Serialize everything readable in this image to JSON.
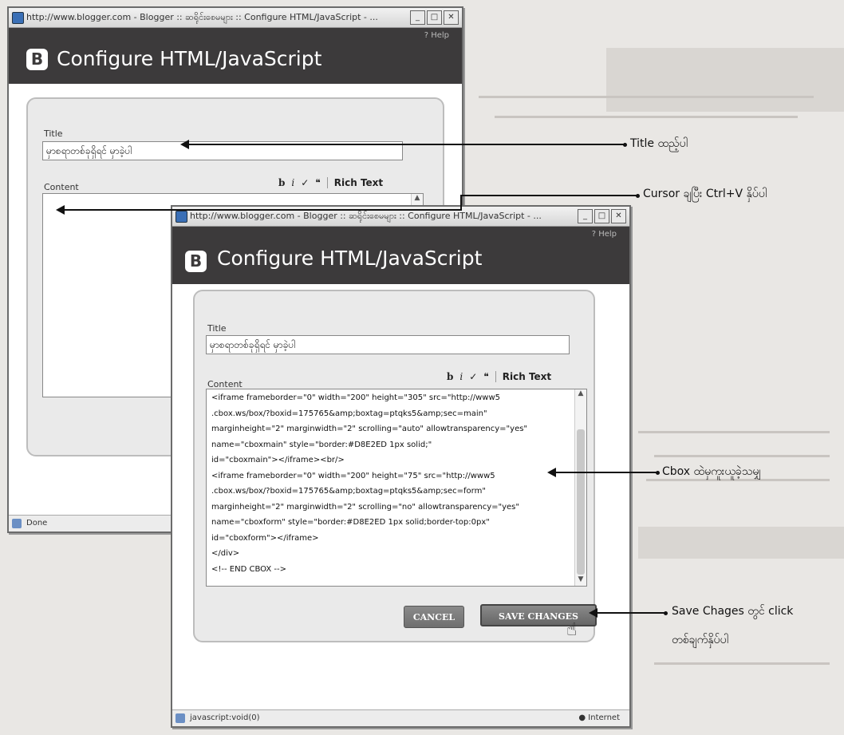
{
  "back_window": {
    "titlebar": "http://www.blogger.com - Blogger :: ဆရိုင်းစေမများ :: Configure HTML/JavaScript - ...",
    "help": "? Help",
    "header_title": "Configure HTML/JavaScript",
    "title_label": "Title",
    "title_value": "မှာစရာတစ်ခုရှိရင် မှာခဲ့ပါ",
    "content_label": "Content",
    "toolbar": {
      "bold": "b",
      "italic": "i",
      "rich_text": "Rich Text"
    },
    "status": "Done"
  },
  "front_window": {
    "titlebar": "http://www.blogger.com - Blogger :: ဆရိုင်းစေမများ :: Configure HTML/JavaScript - ...",
    "help": "? Help",
    "header_title": "Configure HTML/JavaScript",
    "title_label": "Title",
    "title_value": "မှာစရာတစ်ခုရှိရင် မှာခဲ့ပါ",
    "content_label": "Content",
    "toolbar": {
      "bold": "b",
      "italic": "i",
      "rich_text": "Rich Text"
    },
    "code_lines": [
      "<iframe frameborder=\"0\" width=\"200\" height=\"305\" src=\"http://www5",
      ".cbox.ws/box/?boxid=175765&amp;boxtag=ptqks5&amp;sec=main\"",
      "marginheight=\"2\" marginwidth=\"2\" scrolling=\"auto\" allowtransparency=\"yes\"",
      "name=\"cboxmain\" style=\"border:#D8E2ED 1px solid;\"",
      "id=\"cboxmain\"></iframe><br/>",
      "<iframe frameborder=\"0\" width=\"200\" height=\"75\" src=\"http://www5",
      ".cbox.ws/box/?boxid=175765&amp;boxtag=ptqks5&amp;sec=form\"",
      "marginheight=\"2\" marginwidth=\"2\" scrolling=\"no\" allowtransparency=\"yes\"",
      "name=\"cboxform\" style=\"border:#D8E2ED 1px solid;border-top:0px\"",
      "id=\"cboxform\"></iframe>",
      "</div>",
      "<!-- END CBOX -->"
    ],
    "cancel_label": "CANCEL",
    "save_label": "SAVE CHANGES",
    "status": "javascript:void(0)",
    "zone": "Internet"
  },
  "annotations": {
    "title": "Title ထည့်ပါ",
    "cursor": "Cursor ချပြီး Ctrl+V နှိပ်ပါ",
    "cbox": "Cbox ထဲမှကူးယူခဲ့သမျှ",
    "save_line1": "Save Chages တွင် click",
    "save_line2": "တစ်ချက်နှိပ်ပါ"
  },
  "colors": {
    "header": "#3c3a3b",
    "panel": "#eaeaea",
    "button": "#777777"
  }
}
